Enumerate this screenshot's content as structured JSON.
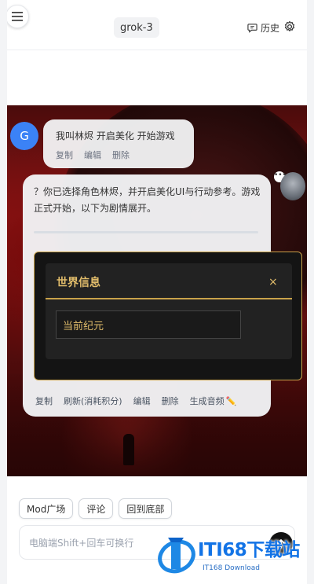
{
  "header": {
    "model": "grok-3",
    "history_label": "历史"
  },
  "user_message": {
    "avatar_letter": "G",
    "text": "我叫林烬 开启美化 开始游戏",
    "actions": [
      "复制",
      "编辑",
      "删除"
    ]
  },
  "bot_message": {
    "text": "？你已选择角色林烬，并开启美化UI与行动参考。游戏正式开始，以下为剧情展开。",
    "menu_dots": "•••",
    "world_panel": {
      "title": "世界信息",
      "close": "×",
      "era_label": "当前纪元"
    },
    "actions": [
      "复制",
      "刷新(消耗积分)",
      "编辑",
      "删除",
      "生成音频"
    ]
  },
  "chips": [
    "Mod广场",
    "评论",
    "回到底部"
  ],
  "input": {
    "placeholder": "电脑端Shift+回车可换行"
  },
  "watermark": {
    "main": "ITI68下载站",
    "sub": "IT168 Download"
  },
  "colors": {
    "accent_gold": "#c9a24a",
    "avatar_blue": "#3b82f6",
    "watermark_blue": "#1273e6"
  }
}
